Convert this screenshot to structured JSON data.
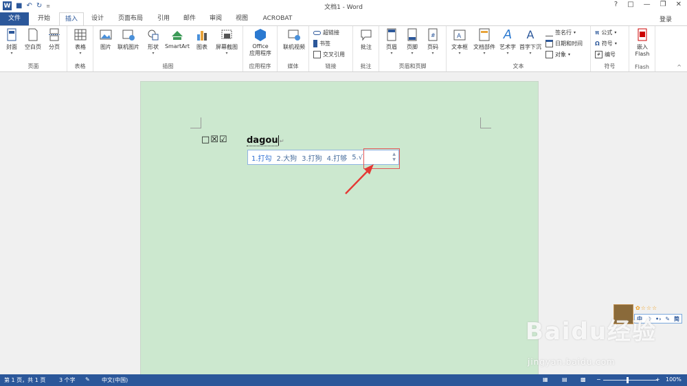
{
  "window": {
    "title": "文档1 - Word",
    "login": "登录"
  },
  "tabs": [
    {
      "label": "文件"
    },
    {
      "label": "开始"
    },
    {
      "label": "插入"
    },
    {
      "label": "设计"
    },
    {
      "label": "页面布局"
    },
    {
      "label": "引用"
    },
    {
      "label": "邮件"
    },
    {
      "label": "审阅"
    },
    {
      "label": "视图"
    },
    {
      "label": "ACROBAT"
    }
  ],
  "ribbon": {
    "groups": {
      "pages": "页面",
      "tables": "表格",
      "illustrations": "插图",
      "apps": "应用程序",
      "media": "媒体",
      "links": "链接",
      "comments": "批注",
      "header_footer": "页眉和页脚",
      "text": "文本",
      "symbols": "符号",
      "flash": "Flash"
    },
    "buttons": {
      "cover": "封面",
      "blank": "空白页",
      "pagebreak": "分页",
      "table": "表格",
      "picture": "图片",
      "online_picture": "联机图片",
      "shapes": "形状",
      "smartart": "SmartArt",
      "chart": "图表",
      "screenshot": "屏幕截图",
      "office_app_1": "Office",
      "office_app_2": "应用程序",
      "online_video": "联机视频",
      "hyperlink": "超链接",
      "bookmark": "书签",
      "crossref": "交叉引用",
      "comment": "批注",
      "header": "页眉",
      "footer": "页脚",
      "pagenum": "页码",
      "textbox": "文本框",
      "quickparts": "文档部件",
      "wordart": "艺术字",
      "dropcap": "首字下沉",
      "signature": "签名行",
      "datetime": "日期和时间",
      "object": "对象",
      "equation": "公式",
      "symbol": "符号",
      "number": "编号",
      "embed_1": "嵌入",
      "embed_2": "Flash"
    }
  },
  "document": {
    "checkboxes": "□☒☑",
    "typed_text": "dagou",
    "paragraph_mark": "↵"
  },
  "ime": {
    "candidates": [
      "1.打勾",
      "2.大狗",
      "3.打狗",
      "4.打够",
      "5.√"
    ],
    "toolbar": [
      "中",
      "☽",
      "•›",
      "✎",
      "简"
    ],
    "stars": "✿☆☆☆"
  },
  "watermark": {
    "brand": "Baidu经验",
    "url": "jingyan.baidu.com"
  },
  "status": {
    "page": "第 1 页，共 1 页",
    "words": "3 个字",
    "language": "中文(中国)",
    "zoom": "100%"
  },
  "colors": {
    "accent": "#2b579a",
    "page_bg": "#cce8cf",
    "highlight": "#e25555"
  }
}
